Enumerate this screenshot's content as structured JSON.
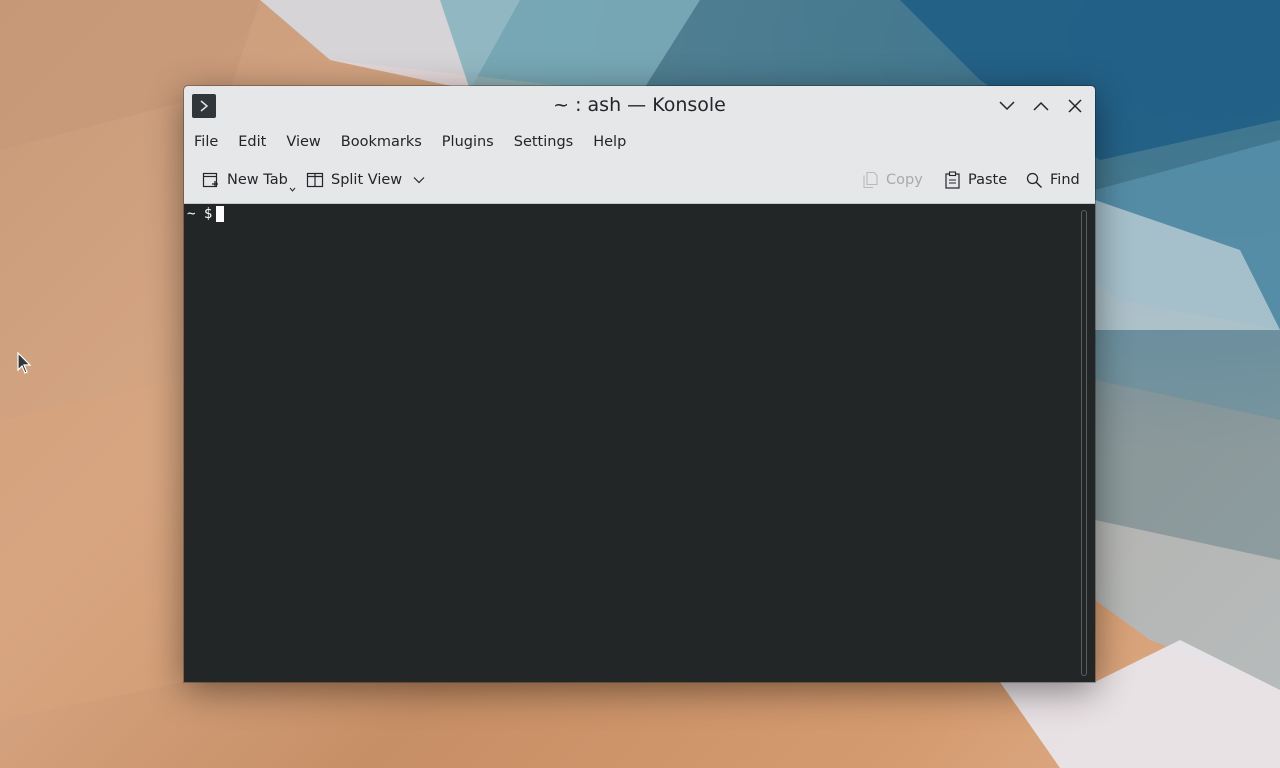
{
  "window": {
    "title": "~ : ash — Konsole",
    "app_icon": "konsole-icon"
  },
  "window_controls": {
    "minimize_icon": "chevron-down-icon",
    "maximize_icon": "chevron-up-icon",
    "close_icon": "close-icon"
  },
  "menubar": {
    "items": [
      "File",
      "Edit",
      "View",
      "Bookmarks",
      "Plugins",
      "Settings",
      "Help"
    ]
  },
  "toolbar": {
    "new_tab_label": "New Tab",
    "split_view_label": "Split View",
    "copy_label": "Copy",
    "paste_label": "Paste",
    "find_label": "Find"
  },
  "terminal": {
    "prompt": "~ $"
  },
  "colors": {
    "terminal_bg": "#232627",
    "terminal_fg": "#fcfcfc",
    "chrome_bg": "#e5e7e9",
    "disabled_text": "#a8abae"
  }
}
